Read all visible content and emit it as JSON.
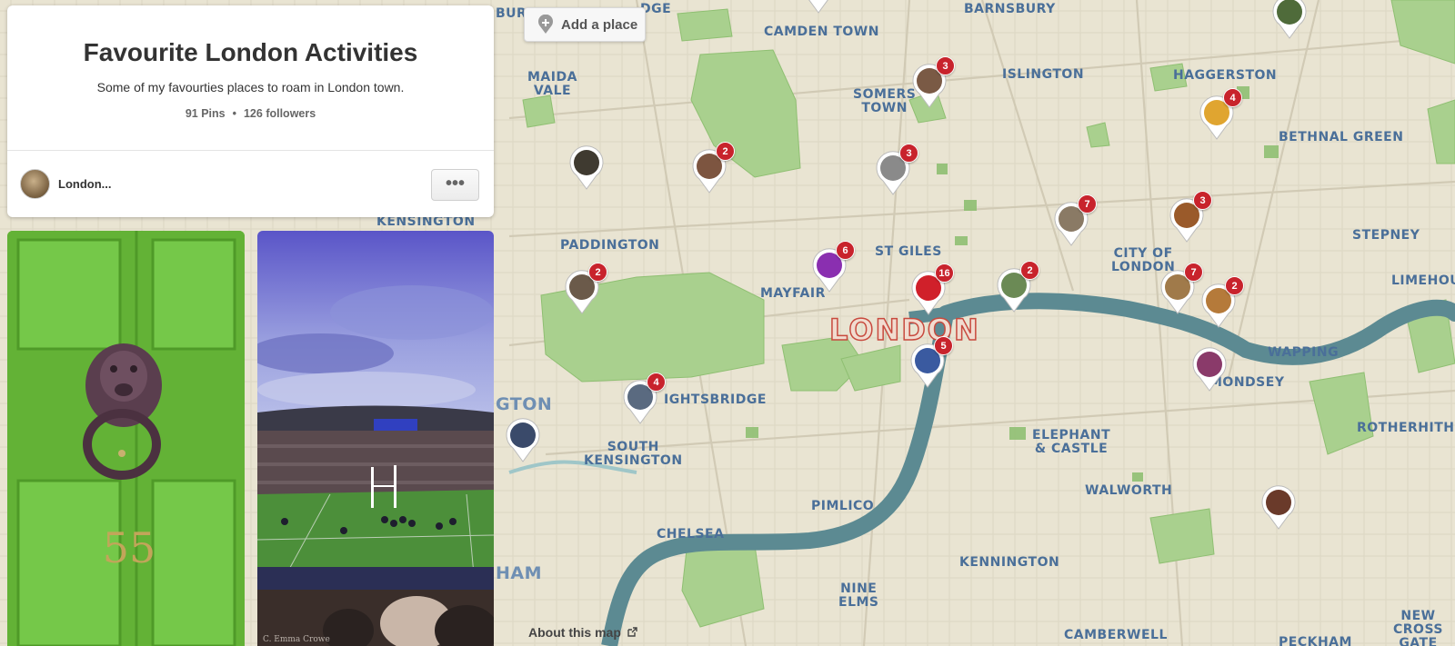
{
  "board": {
    "title": "Favourite London Activities",
    "description": "Some of my favourties places to roam in London town.",
    "pins_count": "91 Pins",
    "separator": "•",
    "followers": "126 followers",
    "owner_name": "London...",
    "more_label": "•••"
  },
  "map": {
    "add_place_label": "Add a place",
    "about_label": "About this map",
    "city_label": "LONDON",
    "labels": {
      "burn": "BURN",
      "dge": "DGE",
      "camden_town": "CAMDEN TOWN",
      "barnsbury": "BARNSBURY",
      "maida_vale": "MAIDA\nVALE",
      "somers_town": "SOMERS\nTOWN",
      "islington": "ISLINGTON",
      "haggerston": "HAGGERSTON",
      "bethnal_green": "BETHNAL GREEN",
      "kensington_top": "KENSINGTON",
      "paddington": "PADDINGTON",
      "st_giles": "ST GILES",
      "city_of_london": "CITY OF\nLONDON",
      "stepney": "STEPNEY",
      "limehouse": "LIMEHOUSE",
      "mayfair": "MAYFAIR",
      "wapping": "WAPPING",
      "ightsbridge": "IGHTSBRIDGE",
      "gton": "GTON",
      "south_kensington": "SOUTH\nKENSINGTON",
      "mondsey": "MONDSEY",
      "elephant_castle": "ELEPHANT\n& CASTLE",
      "rotherhithe": "ROTHERHITHE",
      "walworth": "WALWORTH",
      "pimlico": "PIMLICO",
      "chelsea": "CHELSEA",
      "ham": "HAM",
      "kennington": "KENNINGTON",
      "nine_elms": "NINE\nELMS",
      "camberwell": "CAMBERWELL",
      "peckham": "PECKHAM",
      "new_cross_gate": "NEW\nCROSS\nGATE"
    },
    "pins": [
      {
        "name": "pin-camden",
        "count": ""
      },
      {
        "name": "pin-islington",
        "count": "3"
      },
      {
        "name": "pin-haggerston-north",
        "count": ""
      },
      {
        "name": "pin-haggerston",
        "count": "4"
      },
      {
        "name": "pin-regents-park",
        "count": "2"
      },
      {
        "name": "pin-euston",
        "count": "3"
      },
      {
        "name": "pin-maida-vale",
        "count": ""
      },
      {
        "name": "pin-clerkenwell",
        "count": "7"
      },
      {
        "name": "pin-shoreditch",
        "count": "3"
      },
      {
        "name": "pin-oxford-street",
        "count": "6"
      },
      {
        "name": "pin-paddington",
        "count": "2"
      },
      {
        "name": "pin-covent-garden",
        "count": "16"
      },
      {
        "name": "pin-st-pauls",
        "count": "2"
      },
      {
        "name": "pin-tower",
        "count": "7"
      },
      {
        "name": "pin-tower-east",
        "count": "2"
      },
      {
        "name": "pin-westminster",
        "count": "5"
      },
      {
        "name": "pin-bermondsey",
        "count": ""
      },
      {
        "name": "pin-knightsbridge",
        "count": "4"
      },
      {
        "name": "pin-kensington",
        "count": ""
      },
      {
        "name": "pin-south-bermondsey",
        "count": ""
      }
    ]
  },
  "photos": {
    "door_number": "55",
    "stadium_credit": "C. Emma Crowe"
  },
  "colors": {
    "map_bg": "#e9e4d2",
    "park": "#a9d08e",
    "river": "#5c8a92",
    "label": "#4a6f99",
    "badge": "#c8232c"
  }
}
